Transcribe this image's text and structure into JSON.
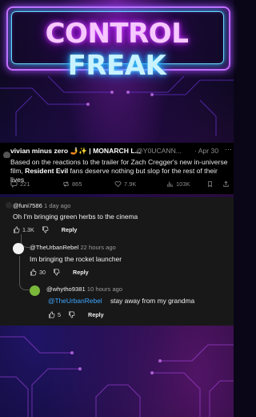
{
  "header": {
    "title_word1": "CONTROL",
    "title_word2": "FREAK"
  },
  "tweet": {
    "author_name": "vivian minus zero 🤳✨ | MONARCH L...",
    "handle": "@Y0UCANN...",
    "separator": "·",
    "date": "Apr 30",
    "more": "⋯",
    "text_part1": "Based on the reactions to the trailer for Zach Cregger's new in-universe film, ",
    "text_bold": "Resident Evil",
    "text_part2": " fans deserve nothing but slop for the rest of their lives",
    "stats": {
      "replies": "221",
      "reposts": "865",
      "likes": "7.9K",
      "views": "103K"
    }
  },
  "comments": [
    {
      "user": "@funi7586",
      "time": "1 day ago",
      "text": "Oh I'm bringing green herbs to the cinema",
      "likes": "1.3K",
      "reply_label": "Reply"
    },
    {
      "user": "@TheUrbanRebel",
      "time": "22 hours ago",
      "text": "Im bringing the rocket launcher",
      "likes": "30",
      "reply_label": "Reply"
    },
    {
      "user": "@whytho9381",
      "time": "10 hours ago",
      "mention": "@TheUrbanRebel",
      "text": "stay away from my grandma",
      "likes": "5",
      "reply_label": "Reply"
    }
  ],
  "colors": {
    "neon_pink": "#d24dff",
    "neon_blue": "#3fd0ff",
    "mention_blue": "#3ea6ff",
    "comment_bg": "#181818",
    "tweet_bg": "#000000"
  }
}
